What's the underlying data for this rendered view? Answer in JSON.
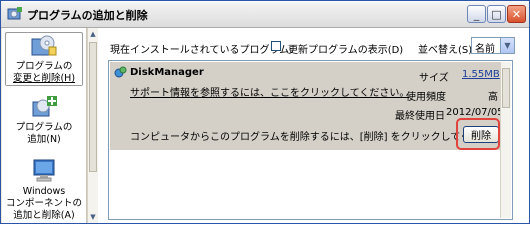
{
  "window": {
    "title": "プログラムの追加と削除",
    "minimize_glyph": "_",
    "maximize_glyph": "□",
    "close_glyph": "✕"
  },
  "sidebar": {
    "items": [
      {
        "label_line1": "プログラムの",
        "label_line2": "変更と削除(H)",
        "icon": "cd-box-icon",
        "selected": true
      },
      {
        "label_line1": "プログラムの",
        "label_line2": "追加(N)",
        "icon": "cd-add-icon",
        "selected": false
      },
      {
        "label_line1": "Windows",
        "label_line2": "コンポーネントの",
        "label_line3": "追加と削除(A)",
        "icon": "windows-components-icon",
        "selected": false
      }
    ]
  },
  "main": {
    "installed_label": "現在インストールされているプログラム:",
    "show_updates_label": "更新プログラムの表示(D)",
    "sort_label": "並べ替え(S):",
    "sort_value": "名前",
    "program": {
      "name": "DiskManager",
      "support_link": "サポート情報を参照するには、ここをクリックしてください。",
      "size_label": "サイズ",
      "size_value": "1.55MB",
      "frequency_label": "使用頻度",
      "frequency_value": "高",
      "last_used_label": "最終使用日",
      "last_used_value": "2012/07/05",
      "remove_message": "コンピュータからこのプログラムを削除するには、[削除] をクリックしてください。",
      "remove_button": "削除"
    }
  },
  "colors": {
    "selected_row": "#d4d0c8",
    "highlight_ring": "#e0443c",
    "window_border": "#2b55a8"
  }
}
